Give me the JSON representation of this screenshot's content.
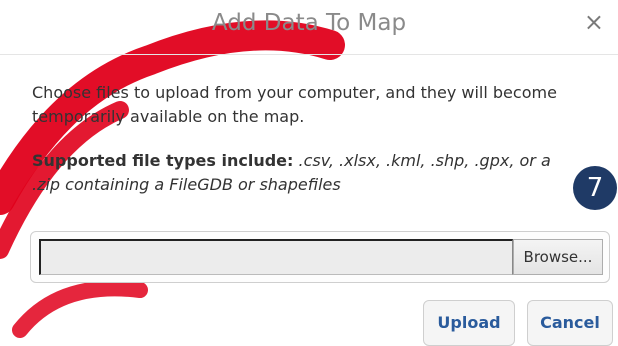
{
  "dialog": {
    "title": "Add Data To Map",
    "close_glyph": "×",
    "intro_text": "Choose files to upload from your computer, and they will become temporarily available on the map.",
    "types_label": "Supported file types include:",
    "types_list": " .csv, .xlsx, .kml, .shp, .gpx, or a .zip containing a FileGDB or shapefiles",
    "step_number": "7",
    "file_input": {
      "value": "",
      "browse_label": "Browse..."
    },
    "buttons": {
      "upload_label": "Upload",
      "cancel_label": "Cancel"
    }
  },
  "colors": {
    "title": "#8a8a8a",
    "accent": "#2a5b9c",
    "badge": "#1f3a66",
    "watermark": "#e0001b"
  },
  "icons": {
    "close": "close-icon"
  }
}
